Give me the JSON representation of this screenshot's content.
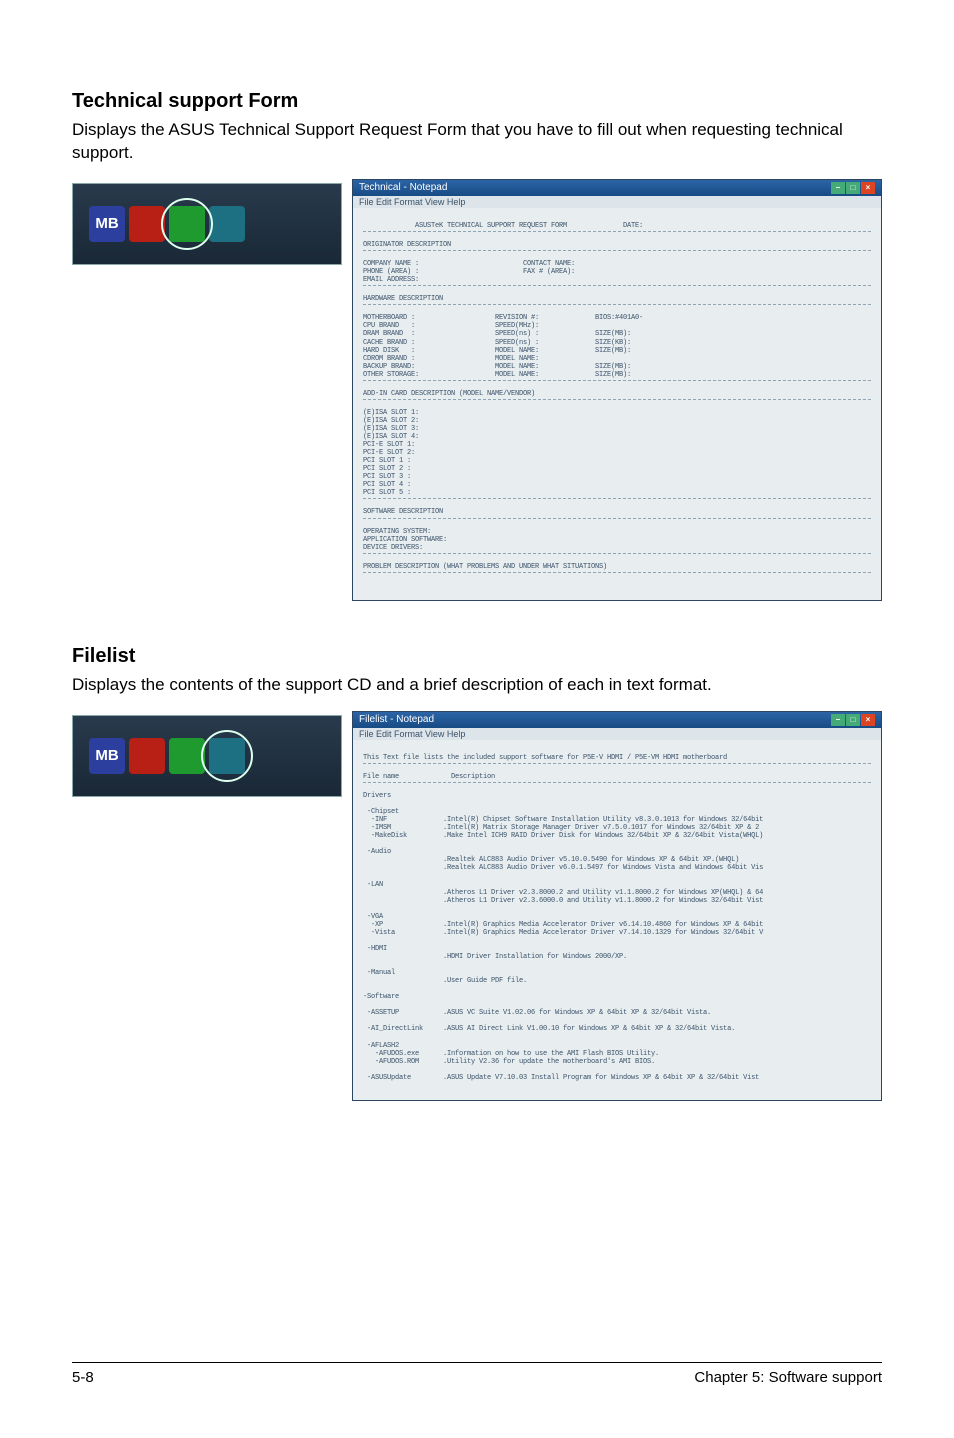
{
  "sections": {
    "support": {
      "title": "Technical support Form",
      "desc": "Displays the ASUS Technical Support Request Form that you have to fill out when requesting technical support."
    },
    "filelist": {
      "title": "Filelist",
      "desc": "Displays the contents of the support CD and a brief description of each in text format."
    }
  },
  "thumb_icons": {
    "mb": "MB",
    "red": "",
    "grn": "",
    "cyn": ""
  },
  "support_window": {
    "title": "Technical - Notepad",
    "menu": "File  Edit  Format  View  Help",
    "lines": {
      "header": "             ASUSTeK TECHNICAL SUPPORT REQUEST FORM              DATE:",
      "orig_h": "ORIGINATOR DESCRIPTION",
      "company": "COMPANY NAME :                          CONTACT NAME:",
      "phone": "PHONE (AREA) :                          FAX # (AREA):",
      "email": "EMAIL ADDRESS:",
      "hw_h": "HARDWARE DESCRIPTION",
      "hw1": "MOTHERBOARD :                    REVISION #:              BIOS:#401A0-",
      "hw2": "CPU BRAND   :                    SPEED(MHz):",
      "hw3": "DRAM BRAND  :                    SPEED(ns) :              SIZE(MB):",
      "hw4": "CACHE BRAND :                    SPEED(ns) :              SIZE(KB):",
      "hw5": "HARD DISK   :                    MODEL NAME:              SIZE(MB):",
      "hw6": "CDROM BRAND :                    MODEL NAME:",
      "hw7": "BACKUP BRAND:                    MODEL NAME:              SIZE(MB):",
      "hw8": "OTHER STORAGE:                   MODEL NAME:              SIZE(MB):",
      "addin_h": "ADD-IN CARD DESCRIPTION (MODEL NAME/VENDOR)",
      "s1": "(E)ISA SLOT 1:",
      "s2": "(E)ISA SLOT 2:",
      "s3": "(E)ISA SLOT 3:",
      "s4": "(E)ISA SLOT 4:",
      "s5": "PCI-E SLOT 1:",
      "s6": "PCI-E SLOT 2:",
      "s7": "PCI SLOT 1 :",
      "s8": "PCI SLOT 2 :",
      "s9": "PCI SLOT 3 :",
      "s10": "PCI SLOT 4 :",
      "s11": "PCI SLOT 5 :",
      "sw_h": "SOFTWARE DESCRIPTION",
      "os": "OPERATING SYSTEM:",
      "app": "APPLICATION SOFTWARE:",
      "drv": "DEVICE DRIVERS:",
      "prob": "PROBLEM DESCRIPTION (WHAT PROBLEMS AND UNDER WHAT SITUATIONS)"
    }
  },
  "filelist_window": {
    "title": "Filelist - Notepad",
    "menu": "File  Edit  Format  View  Help",
    "lines": {
      "header": "This Text file lists the included support software for P5E-V HDMI / P5E-VM HDMI motherboard",
      "cols": "File name             Description",
      "drivers_h": "Drivers",
      "chipset": " -Chipset",
      "inf": "  -INF              .Intel(R) Chipset Software Installation Utility v8.3.0.1013 for Windows 32/64bit",
      "imsm": "  -IMSM             .Intel(R) Matrix Storage Manager Driver v7.5.0.1017 for Windows 32/64bit XP & 2",
      "makedisk": "  -MakeDisk         .Make Intel ICH9 RAID Driver Disk for Windows 32/64bit XP & 32/64bit Vista(WHQL)",
      "audio_h": " -Audio",
      "audio1": "                    .Realtek ALC883 Audio Driver v5.10.0.5490 for Windows XP & 64bit XP.(WHQL)",
      "audio2": "                    .Realtek ALC883 Audio Driver v6.0.1.5497 for Windows Vista and Windows 64bit Vis",
      "lan_h": " -LAN",
      "lan1": "                    .Atheros L1 Driver v2.3.8000.2 and Utility v1.1.8000.2 for Windows XP(WHQL) & 64",
      "lan2": "                    .Atheros L1 Driver v2.3.6000.0 and Utility v1.1.8000.2 for Windows 32/64bit Vist",
      "vga_h": " -VGA",
      "vga1": "  -XP               .Intel(R) Graphics Media Accelerator Driver v6.14.10.4860 for Windows XP & 64bit",
      "vga2": "  -Vista            .Intel(R) Graphics Media Accelerator Driver v7.14.10.1329 for Windows 32/64bit V",
      "hdmi_h": " -HDMI",
      "hdmi": "                    .HDMI Driver Installation for Windows 2000/XP.",
      "manual_h": " -Manual",
      "manual": "                    .User Guide PDF file.",
      "software_h": "-Software",
      "asussetup": " -ASSETUP           .ASUS VC Suite V1.02.06 for Windows XP & 64bit XP & 32/64bit Vista.",
      "aidirect": " -AI_DirectLink     .ASUS AI Direct Link V1.00.10 for Windows XP & 64bit XP & 32/64bit Vista.",
      "aflash_h": " -AFLASH2",
      "aflash1": "   -AFUDOS.exe      .Information on how to use the AMI Flash BIOS Utility.",
      "aflash2": "   -AFUDOS.ROM      .Utility V2.36 for update the motherboard's AMI BIOS.",
      "asusupdate": " -ASUSUpdate        .ASUS Update V7.10.03 Install Program for Windows XP & 64bit XP & 32/64bit Vist"
    }
  },
  "footer": {
    "left": "5-8",
    "right": "Chapter 5: Software support"
  }
}
